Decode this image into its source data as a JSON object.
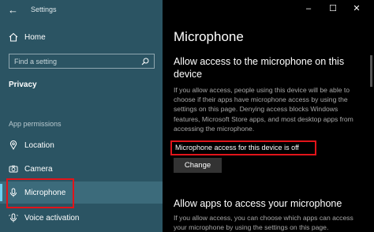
{
  "window": {
    "title": "Settings",
    "controls": [
      "–",
      "☐",
      "✕"
    ]
  },
  "sidebar": {
    "home_label": "Home",
    "search_placeholder": "Find a setting",
    "section_title": "Privacy",
    "group_title": "App permissions",
    "items": [
      {
        "label": "Location",
        "icon": "location-icon"
      },
      {
        "label": "Camera",
        "icon": "camera-icon"
      },
      {
        "label": "Microphone",
        "icon": "microphone-icon",
        "selected": true
      },
      {
        "label": "Voice activation",
        "icon": "voice-activation-icon"
      }
    ]
  },
  "main": {
    "page_title": "Microphone",
    "allow_device_heading": "Allow access to the microphone on this device",
    "allow_device_body": "If you allow access, people using this device will be able to choose if their apps have microphone access by using the settings on this page. Denying access blocks Windows features, Microsoft Store apps, and most desktop apps from accessing the microphone.",
    "status_text": "Microphone access for this device is off",
    "change_button": "Change",
    "allow_apps_heading": "Allow apps to access your microphone",
    "allow_apps_body": "If you allow access, you can choose which apps can access your microphone by using the settings on this page."
  },
  "colors": {
    "sidebar_bg": "#2b5463",
    "main_bg": "#000000",
    "accent": "#6fd0f0",
    "highlight": "#e2141a"
  }
}
